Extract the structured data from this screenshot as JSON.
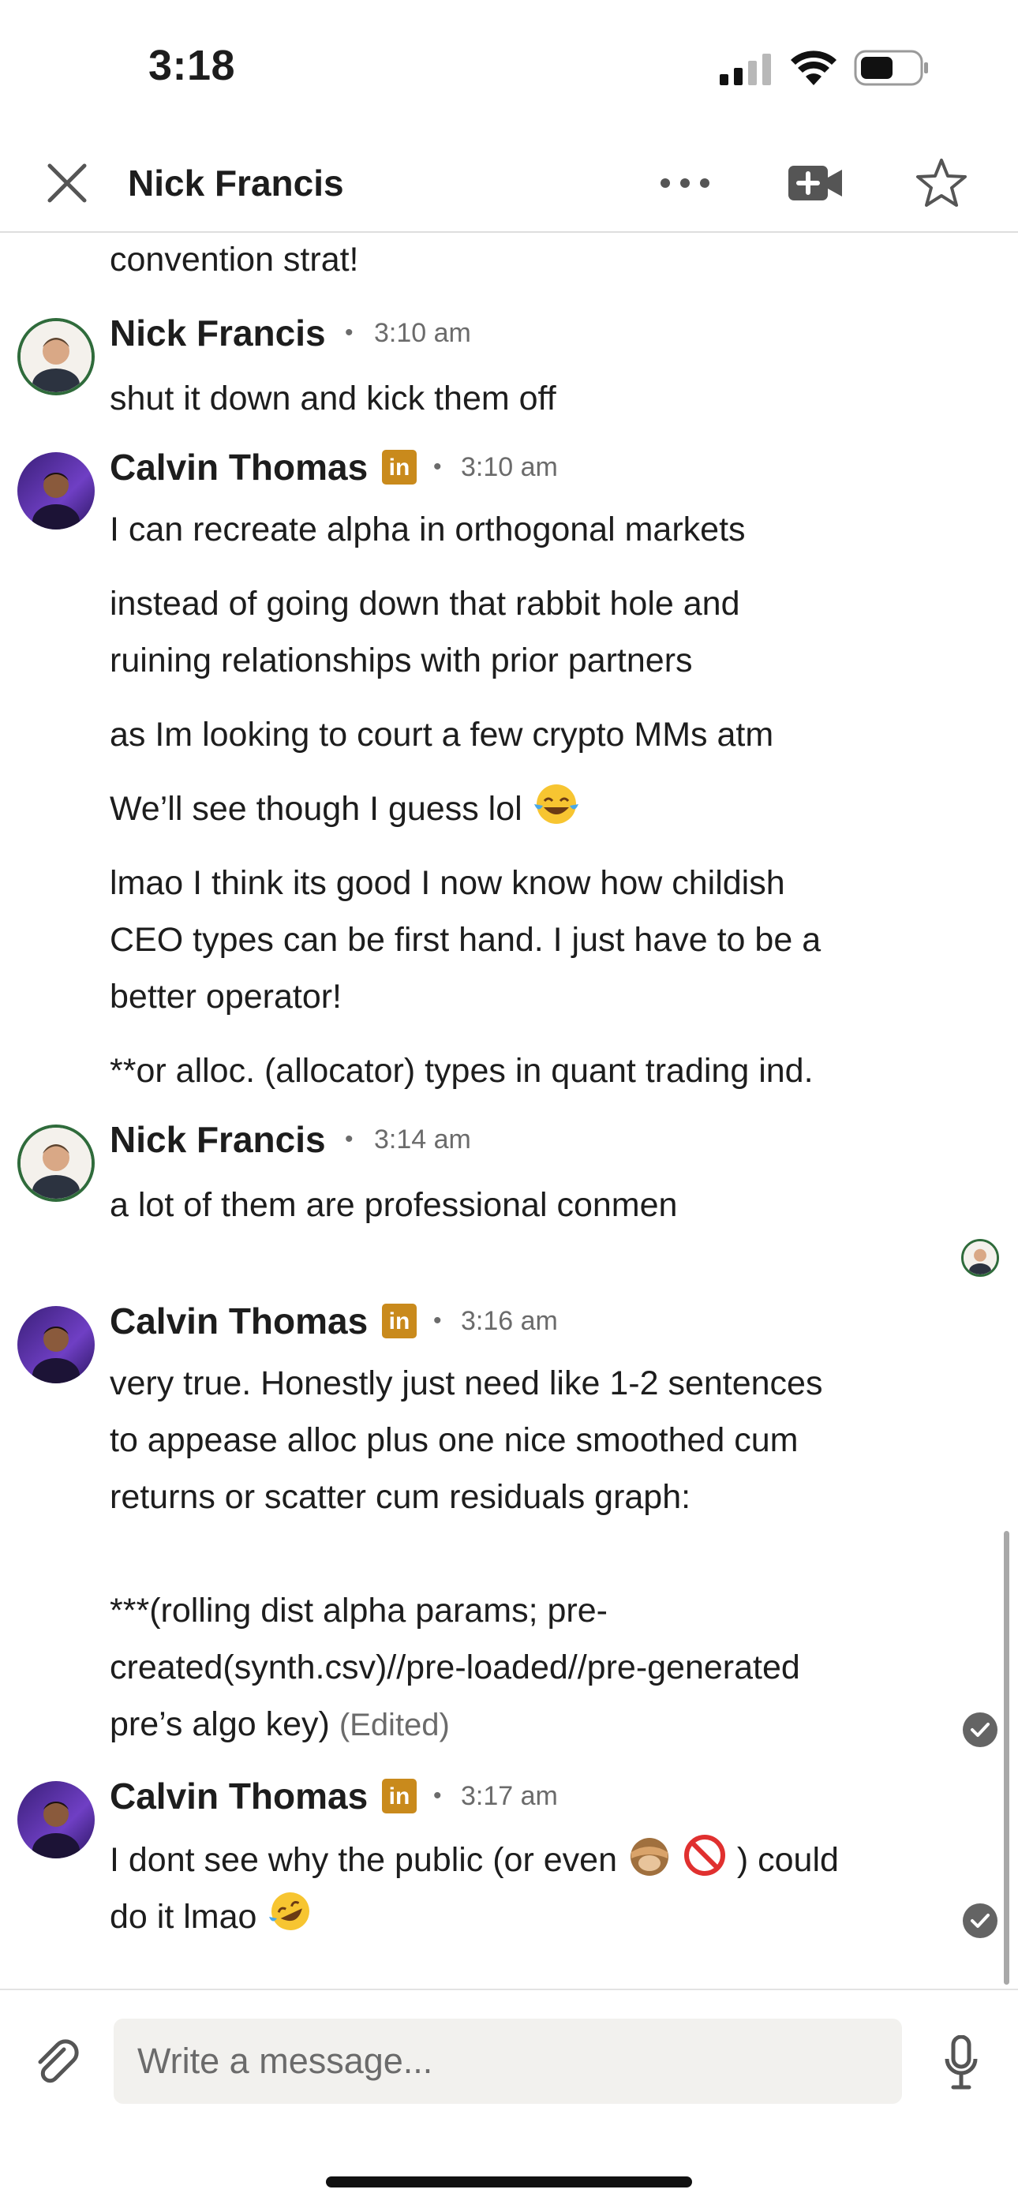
{
  "status_bar": {
    "time": "3:18"
  },
  "header": {
    "title": "Nick Francis"
  },
  "thread": {
    "partial_message": "convention strat!",
    "groups": [
      {
        "sender": "Nick Francis",
        "time": "3:10 am",
        "lines": [
          "shut it down and kick them off"
        ]
      },
      {
        "sender": "Calvin Thomas",
        "time": "3:10 am",
        "lines": [
          "I can recreate alpha in orthogonal markets",
          "instead of going down that rabbit hole and",
          "ruining relationships with prior partners",
          "as Im looking to court a few crypto MMs atm",
          "We’ll see though I guess lol",
          "lmao I think its good I now know how childish",
          "CEO types can be first hand. I just have to be a",
          "better operator!",
          "**or alloc. (allocator) types in quant trading ind."
        ]
      },
      {
        "sender": "Nick Francis",
        "time": "3:14 am",
        "lines": [
          "a lot of them are professional conmen"
        ]
      },
      {
        "sender": "Calvin Thomas",
        "time": "3:16 am",
        "lines": [
          "very true. Honestly just need like 1-2 sentences",
          "to appease alloc plus one nice smoothed cum",
          "returns or scatter cum residuals graph:",
          "***(rolling dist alpha params; pre-",
          "created(synth.csv)//pre-loaded//pre-generated",
          "pre’s algo key)"
        ],
        "edited_label": "(Edited)"
      },
      {
        "sender": "Calvin Thomas",
        "time": "3:17 am",
        "lines": [
          "I dont see why the public (or even",
          ") could",
          "do it lmao"
        ]
      }
    ]
  },
  "badge": {
    "linkedin_text": "in"
  },
  "composer": {
    "placeholder": "Write a message..."
  },
  "colors": {
    "linkedin_badge": "#c98a1c",
    "check": "#646464",
    "nick_avatar_ring": "#2f6b3b",
    "calvin_avatar": "#6f3fc4"
  },
  "icons": [
    "close-icon",
    "more-icon",
    "video-call-icon",
    "star-icon",
    "linkedin-icon",
    "read-check-icon",
    "attach-icon",
    "mic-icon",
    "tears-of-joy-emoji",
    "see-no-evil-monkey-emoji",
    "prohibited-emoji",
    "rofl-emoji"
  ]
}
